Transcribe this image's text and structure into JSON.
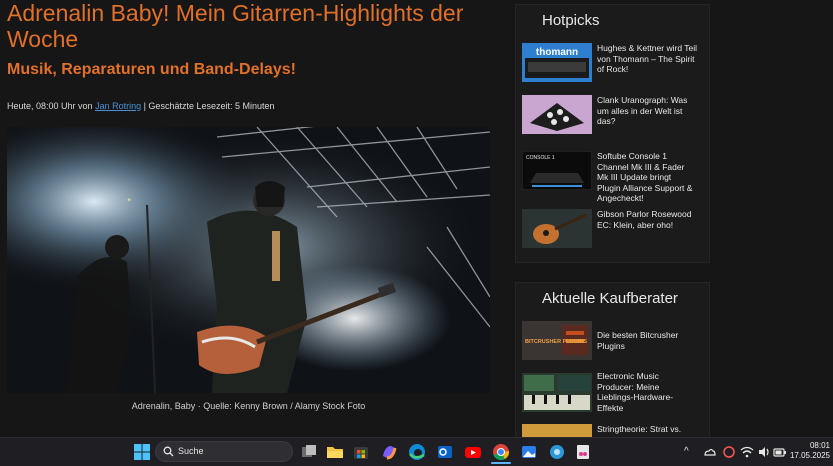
{
  "article": {
    "title": "Adrenalin Baby! Mein Gitarren-Highlights der Woche",
    "subtitle": "Musik, Reparaturen und Band-Delays!",
    "meta_prefix": "Heute, 08:00 Uhr von ",
    "author": "Jan Rotring",
    "meta_suffix": " | Geschätzte Lesezeit: 5 Minuten",
    "caption": "Adrenalin, Baby  ·  Quelle: Kenny Brown / Alamy Stock Foto"
  },
  "hotpicks": {
    "heading": "Hotpicks",
    "items": [
      {
        "text": "Hughes & Kettner wird Teil von Thomann – The Spirit of Rock!",
        "thumb": "thomann-logo"
      },
      {
        "text": "Clank Uranograph: Was um alles in der Welt ist das?",
        "thumb": "synth-device"
      },
      {
        "text": "Softube Console 1 Channel Mk III & Fader Mk III Update bringt Plugin Alliance Support & Angecheckt!",
        "thumb": "console-controller"
      },
      {
        "text": "Gibson Parlor Rosewood EC: Klein, aber oho!",
        "thumb": "acoustic-guitar"
      }
    ]
  },
  "kaufberater": {
    "heading": "Aktuelle Kaufberater",
    "items": [
      {
        "text": "Die besten Bitcrusher Plugins",
        "thumb": "bitcrusher-plugins"
      },
      {
        "text": "Electronic Music Producer: Meine Lieblings-Hardware-Effekte",
        "thumb": "hardware-effects"
      },
      {
        "text": "Stringtheorie: Strat vs.",
        "thumb": "strat-guitar"
      }
    ]
  },
  "taskbar": {
    "search_label": "Suche",
    "time": "08:01",
    "date": "17.05.2025"
  },
  "thumbs": {
    "thomann_text": "thomann",
    "console_text": "CONSOLE 1",
    "bitcrusher_text": "BITCRUSHER PLUGINS"
  }
}
